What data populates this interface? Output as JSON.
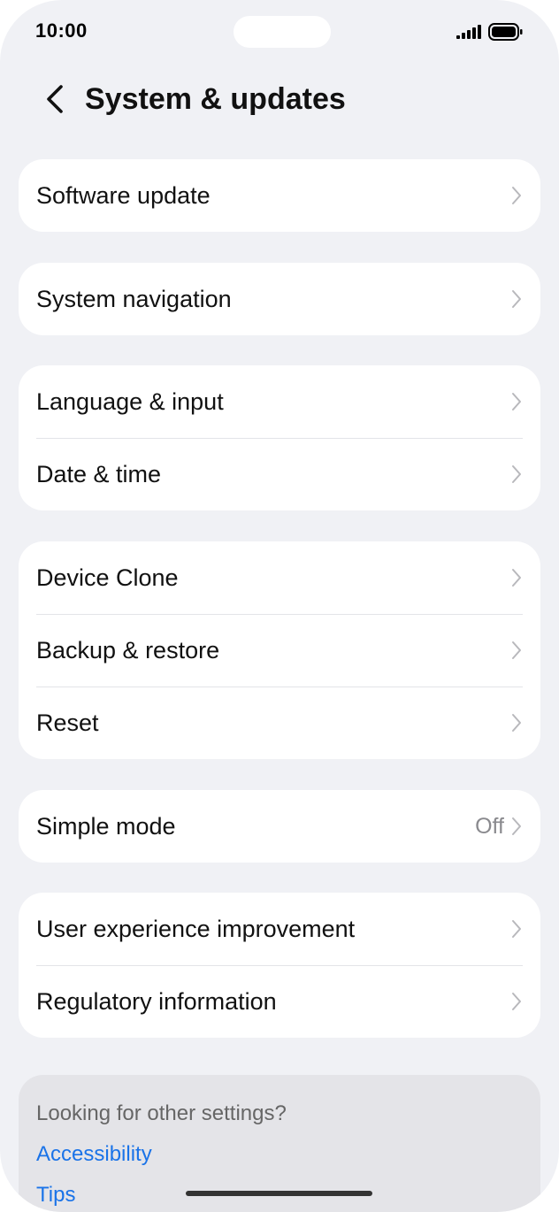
{
  "status_bar": {
    "time": "10:00"
  },
  "header": {
    "title": "System & updates",
    "back_icon": "chevron-left-icon"
  },
  "groups": [
    {
      "items": [
        {
          "label": "Software update"
        }
      ]
    },
    {
      "items": [
        {
          "label": "System navigation"
        }
      ]
    },
    {
      "items": [
        {
          "label": "Language & input"
        },
        {
          "label": "Date & time"
        }
      ]
    },
    {
      "items": [
        {
          "label": "Device Clone"
        },
        {
          "label": "Backup & restore"
        },
        {
          "label": "Reset"
        }
      ]
    },
    {
      "items": [
        {
          "label": "Simple mode",
          "value": "Off"
        }
      ]
    },
    {
      "items": [
        {
          "label": "User experience improvement"
        },
        {
          "label": "Regulatory information"
        }
      ]
    }
  ],
  "suggestions": {
    "title": "Looking for other settings?",
    "links": [
      "Accessibility",
      "Tips"
    ]
  },
  "colors": {
    "background": "#f0f1f5",
    "card": "#ffffff",
    "link": "#1a73e8",
    "secondary_text": "#8a8a8e"
  }
}
